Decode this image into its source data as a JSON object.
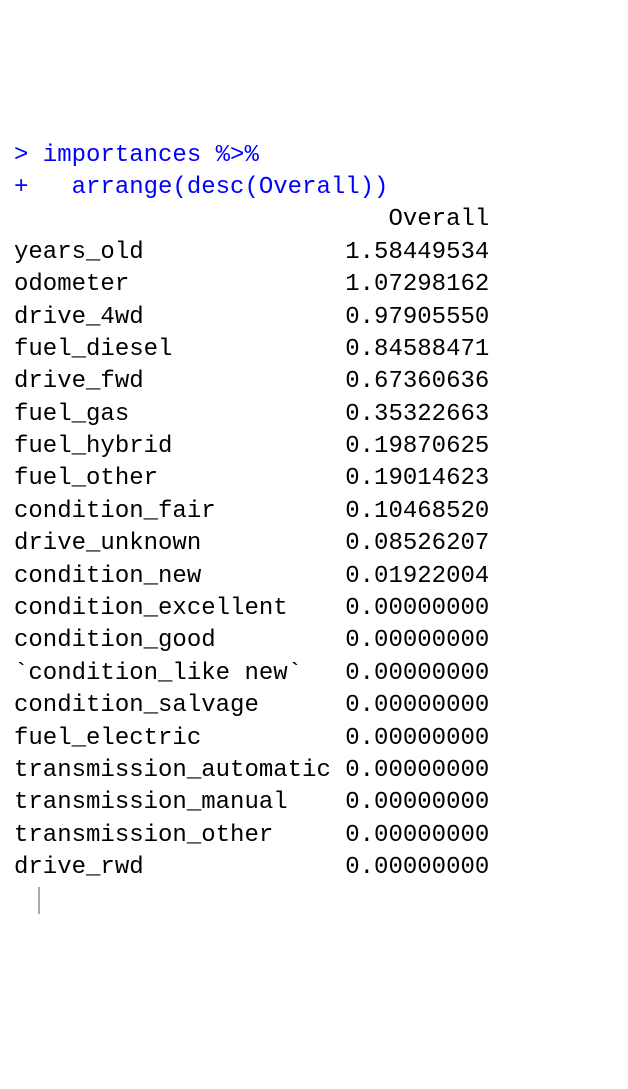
{
  "console": {
    "prompt_lines": [
      "> importances %>%",
      "+   arrange(desc(Overall))"
    ],
    "header_label": "Overall",
    "name_col_width": 23,
    "value_col_width": 10,
    "rows": [
      {
        "name": "years_old",
        "value": "1.58449534"
      },
      {
        "name": "odometer",
        "value": "1.07298162"
      },
      {
        "name": "drive_4wd",
        "value": "0.97905550"
      },
      {
        "name": "fuel_diesel",
        "value": "0.84588471"
      },
      {
        "name": "drive_fwd",
        "value": "0.67360636"
      },
      {
        "name": "fuel_gas",
        "value": "0.35322663"
      },
      {
        "name": "fuel_hybrid",
        "value": "0.19870625"
      },
      {
        "name": "fuel_other",
        "value": "0.19014623"
      },
      {
        "name": "condition_fair",
        "value": "0.10468520"
      },
      {
        "name": "drive_unknown",
        "value": "0.08526207"
      },
      {
        "name": "condition_new",
        "value": "0.01922004"
      },
      {
        "name": "condition_excellent",
        "value": "0.00000000"
      },
      {
        "name": "condition_good",
        "value": "0.00000000"
      },
      {
        "name": "`condition_like new`",
        "value": "0.00000000"
      },
      {
        "name": "condition_salvage",
        "value": "0.00000000"
      },
      {
        "name": "fuel_electric",
        "value": "0.00000000"
      },
      {
        "name": "transmission_automatic",
        "value": "0.00000000"
      },
      {
        "name": "transmission_manual",
        "value": "0.00000000"
      },
      {
        "name": "transmission_other",
        "value": "0.00000000"
      },
      {
        "name": "drive_rwd",
        "value": "0.00000000"
      }
    ]
  }
}
